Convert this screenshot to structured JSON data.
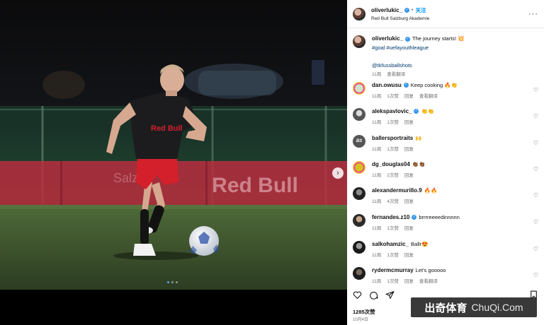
{
  "post": {
    "username": "oliverlukic_",
    "follow_separator": "•",
    "follow_label": "关注",
    "subtitle": "Red Bull Salzburg Akademie",
    "more": "···"
  },
  "caption": {
    "username": "oliverlukic_",
    "text": "The journey starts! 💥",
    "hashtags": "#goal #uefayouthleague",
    "mention": "@tkfussballshots",
    "time": "11周",
    "translate": "查看翻译"
  },
  "comments": [
    {
      "username": "dan.owusu",
      "text": "Keep cooking 🔥👏",
      "time": "11周",
      "likes": "1次赞",
      "reply": "回复",
      "translate": "查看翻译"
    },
    {
      "username": "alekspavlovic_",
      "text": "👏👏",
      "time": "11周",
      "likes": "1次赞",
      "reply": "回复",
      "translate": ""
    },
    {
      "username": "ballersportraits",
      "text": "🙌",
      "time": "11周",
      "likes": "1次赞",
      "reply": "回复",
      "translate": ""
    },
    {
      "username": "dg_douglas04",
      "text": "👏🏾👏🏾",
      "time": "11周",
      "likes": "2次赞",
      "reply": "回复",
      "translate": ""
    },
    {
      "username": "alexandermurillo.9",
      "text": "🔥🔥",
      "time": "11周",
      "likes": "4次赞",
      "reply": "回复",
      "translate": ""
    },
    {
      "username": "fernandes.z10",
      "text": "brrrreeeedinnnnn",
      "time": "11周",
      "likes": "1次赞",
      "reply": "回复",
      "translate": ""
    },
    {
      "username": "salkohamzic_",
      "text": "Ballr😍",
      "time": "11周",
      "likes": "1次赞",
      "reply": "回复",
      "translate": ""
    },
    {
      "username": "rydermcmurray",
      "text": "Let's gooooo",
      "time": "11周",
      "likes": "1次赞",
      "reply": "回复",
      "translate": "查看翻译"
    }
  ],
  "likes_label": "1285次赞",
  "date_label": "10月4日",
  "watermark": {
    "cn": "出奇体育",
    "en": "ChuQi.Com"
  },
  "photo": {
    "banner_text_1": "Red Bull",
    "shirt_text": "Red Bull"
  },
  "colors": {
    "accent": "#0095f6",
    "verified": "#3897f0",
    "banner": "#c4344a"
  }
}
